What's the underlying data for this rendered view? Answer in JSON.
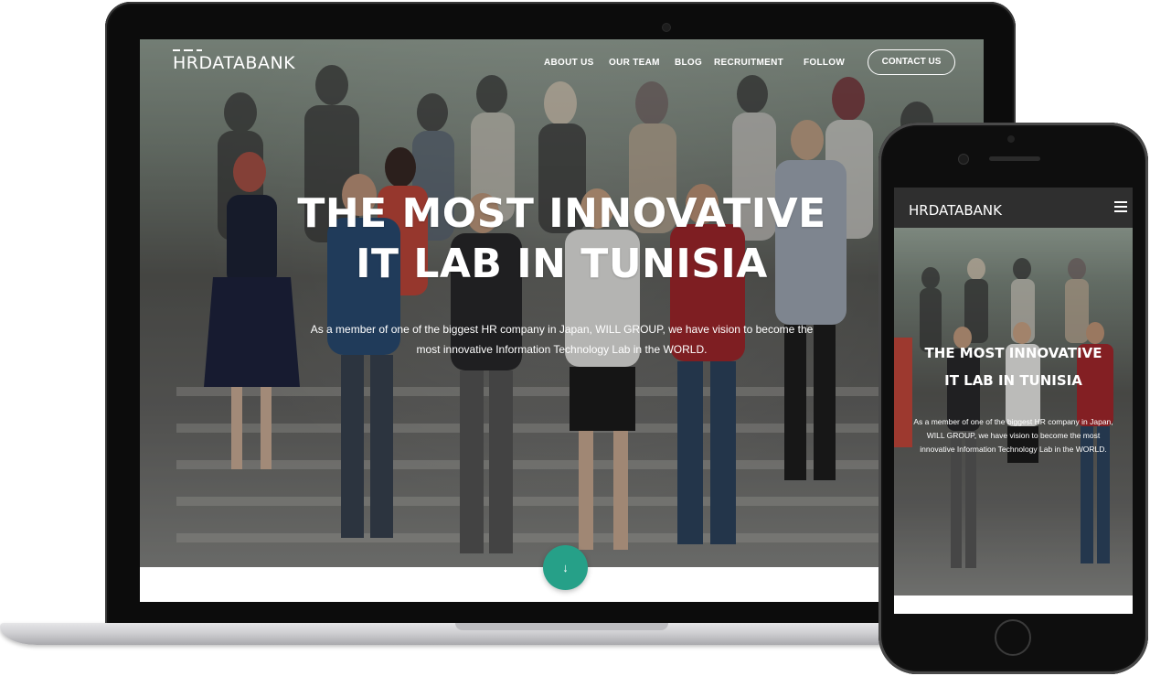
{
  "desktop": {
    "logo": "HRDATABANK",
    "nav": {
      "items": [
        {
          "label": "ABOUT US"
        },
        {
          "label": "OUR TEAM"
        },
        {
          "label": "BLOG"
        },
        {
          "label": "RECRUITMENT"
        },
        {
          "label": "FOLLOW"
        }
      ],
      "contact_label": "CONTACT US"
    },
    "hero": {
      "title_line1": "THE MOST INNOVATIVE",
      "title_line2": "IT LAB IN TUNISIA",
      "subtitle_line1": "As a member of one of the biggest HR company in Japan, WILL GROUP, we have vision to become the",
      "subtitle_line2": "most innovative Information Technology Lab in the WORLD.",
      "scroll_icon": "arrow-down-icon",
      "scroll_glyph": "↓",
      "accent": "#26a088"
    }
  },
  "mobile": {
    "logo": "HRDATABANK",
    "menu_icon": "hamburger-menu-icon",
    "hero": {
      "title_line1": "THE MOST INNOVATIVE",
      "title_line2": "IT LAB IN TUNISIA",
      "subtitle": "As a member of one of the biggest HR company in Japan, WILL GROUP, we have vision to become the most innovative Information Technology Lab in the WORLD."
    }
  }
}
